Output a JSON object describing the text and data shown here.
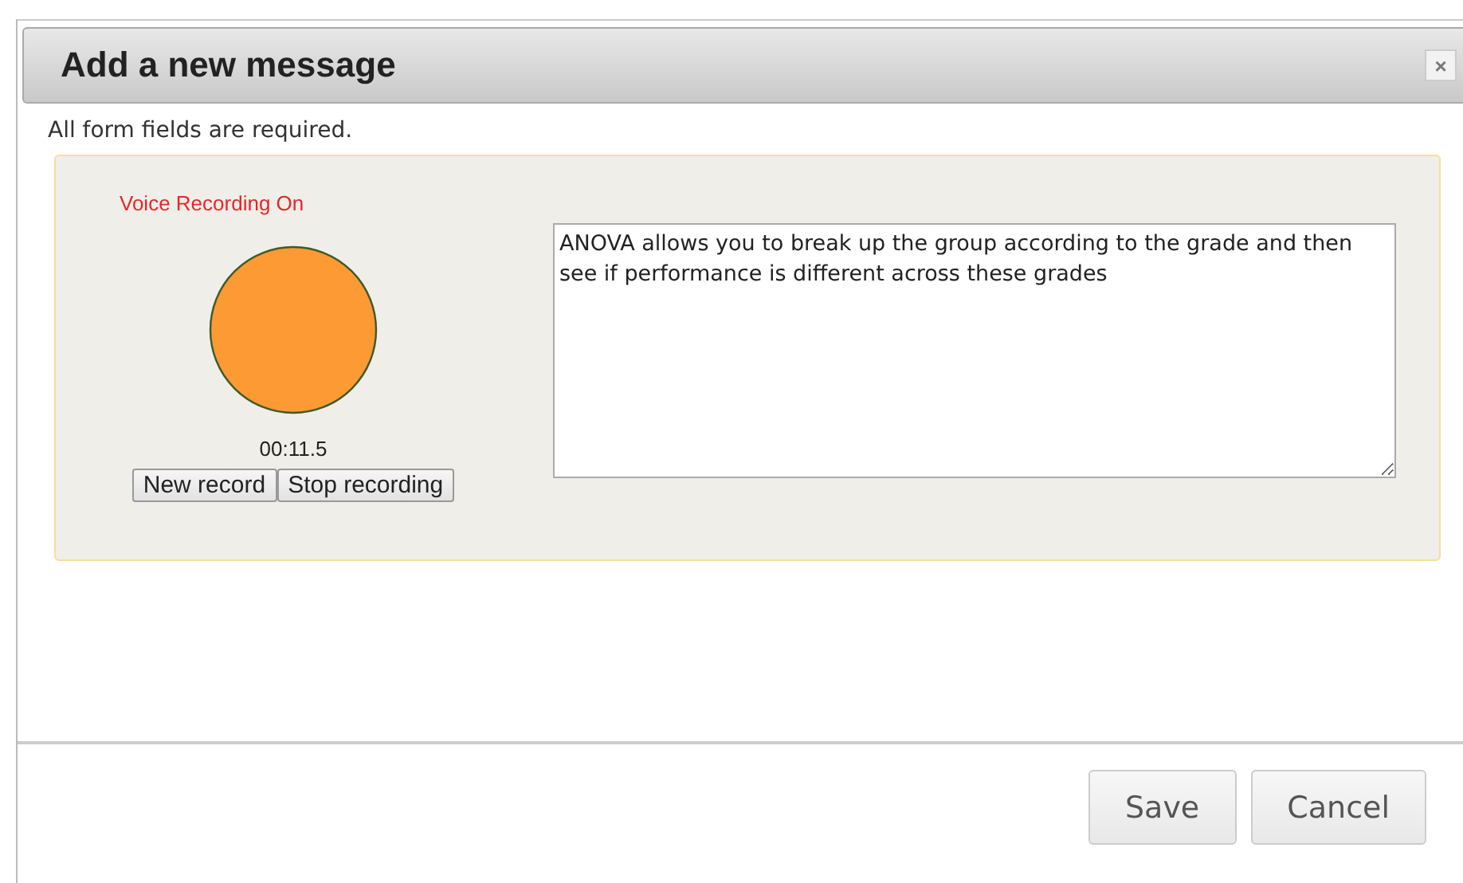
{
  "dialog": {
    "title": "Add a new message",
    "close": "×"
  },
  "note": "All form fields are required.",
  "recorder": {
    "status": "Voice Recording On",
    "recording": true,
    "time": "00:11.5",
    "buttons": [
      "New record",
      "Stop recording"
    ]
  },
  "message": {
    "value": "ANOVA allows you to break up the group according to the grade and then see if performance is different across these grades"
  },
  "buttons": [
    "Save",
    "Cancel"
  ]
}
